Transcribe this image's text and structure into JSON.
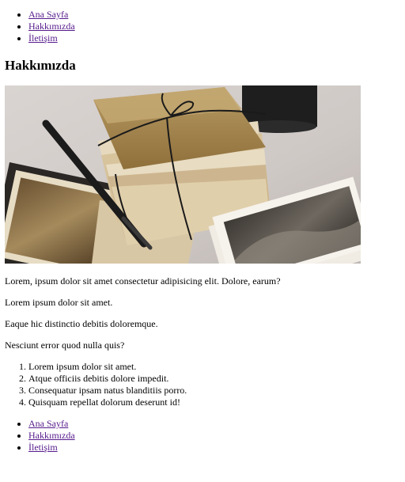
{
  "nav_top": [
    {
      "label": "Ana Sayfa"
    },
    {
      "label": "Hakkımızda"
    },
    {
      "label": "İletişim"
    }
  ],
  "page_title": "Hakkımızda",
  "paragraphs": [
    "Lorem, ipsum dolor sit amet consectetur adipisicing elit. Dolore, earum?",
    "Lorem ipsum dolor sit amet.",
    "Eaque hic distinctio debitis doloremque.",
    "Nesciunt error quod nulla quis?"
  ],
  "ordered_list": [
    "Lorem ipsum dolor sit amet.",
    "Atque officiis debitis dolore impedit.",
    "Consequatur ipsam natus blanditiis porro.",
    "Quisquam repellat dolorum deserunt id!"
  ],
  "nav_bottom": [
    {
      "label": "Ana Sayfa"
    },
    {
      "label": "Hakkımızda"
    },
    {
      "label": "İletişim"
    }
  ],
  "colors": {
    "link": "#551a8b",
    "background": "#ffffff",
    "text": "#000000"
  }
}
